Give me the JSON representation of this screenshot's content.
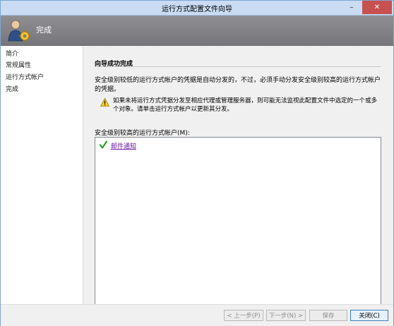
{
  "window": {
    "title": "运行方式配置文件向导",
    "minimize": "–",
    "close": "✕"
  },
  "header": {
    "title": "完成",
    "icon": "user-gear-icon"
  },
  "sidebar": {
    "items": [
      {
        "label": "简介"
      },
      {
        "label": "常规属性"
      },
      {
        "label": "运行方式帐户"
      },
      {
        "label": "完成"
      }
    ]
  },
  "content": {
    "section_title": "向导成功完成",
    "message": "安全级别较低的运行方式帐户的凭据是自动分发的，不过，必须手动分发安全级别较高的运行方式帐户的凭据。",
    "warning": {
      "icon": "warning-icon",
      "text": "如果未将运行方式凭据分发至相应代理或管理服务器，则可能无法监视此配置文件中选定的一个或多个对象。请单击运行方式帐户以更新其分发。"
    },
    "list_label": "安全级别较高的运行方式帐户(M):",
    "accounts": [
      {
        "name": "邮件通知",
        "icon": "check-icon",
        "icon_color": "#2e9a2e"
      }
    ]
  },
  "footer": {
    "prev": "< 上一步(P)",
    "next": "下一步(N) >",
    "save": "保存",
    "close": "关闭(C)"
  },
  "colors": {
    "link": "#6b17a6",
    "header_bg": "#808084",
    "titlebar_bg": "#c9dcf3"
  }
}
